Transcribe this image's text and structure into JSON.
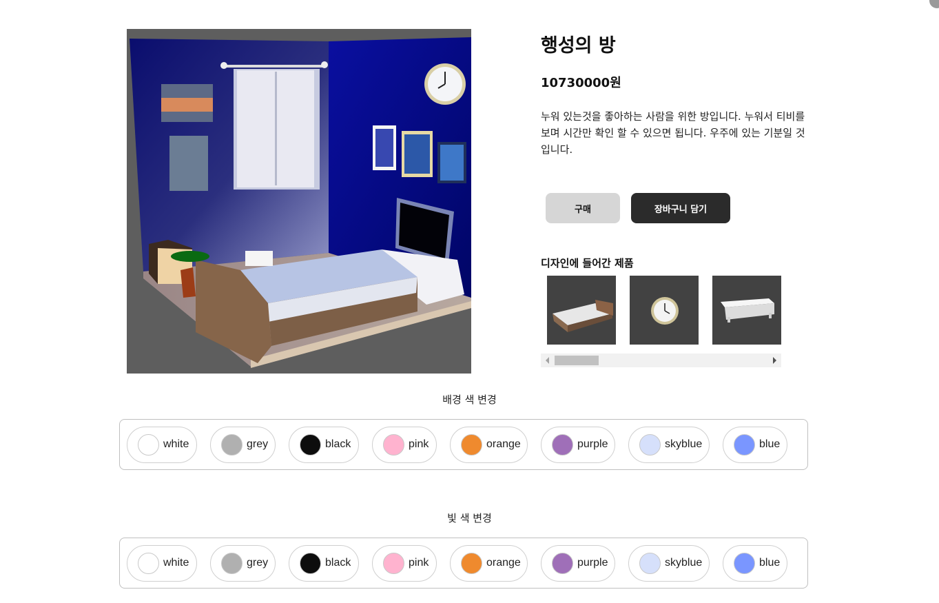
{
  "product": {
    "title": "행성의 방",
    "price": "10730000원",
    "description": "누워 있는것을 좋아하는 사람을 위한 방입니다. 누워서 티비를 보며 시간만 확인 할 수 있으면 됩니다. 우주에 있는 기분일 것입니다."
  },
  "actions": {
    "buy_label": "구매",
    "cart_label": "장바구니 담기"
  },
  "products_section": {
    "heading": "디자인에 들어간 제품",
    "items": [
      "bed",
      "wall-clock",
      "tv-stand"
    ]
  },
  "background_color": {
    "label": "배경 색 변경",
    "options": [
      {
        "name": "white",
        "color": "#ffffff"
      },
      {
        "name": "grey",
        "color": "#b0b0b0"
      },
      {
        "name": "black",
        "color": "#0d0d0d"
      },
      {
        "name": "pink",
        "color": "#ffb3cf"
      },
      {
        "name": "orange",
        "color": "#ef8a2e"
      },
      {
        "name": "purple",
        "color": "#9f6fb8"
      },
      {
        "name": "skyblue",
        "color": "#d6e0fb"
      },
      {
        "name": "blue",
        "color": "#7a96ff"
      }
    ]
  },
  "light_color": {
    "label": "빛 색 변경",
    "options": [
      {
        "name": "white",
        "color": "#ffffff"
      },
      {
        "name": "grey",
        "color": "#b0b0b0"
      },
      {
        "name": "black",
        "color": "#0d0d0d"
      },
      {
        "name": "pink",
        "color": "#ffb3cf"
      },
      {
        "name": "orange",
        "color": "#ef8a2e"
      },
      {
        "name": "purple",
        "color": "#9f6fb8"
      },
      {
        "name": "skyblue",
        "color": "#d6e0fb"
      },
      {
        "name": "blue",
        "color": "#7a96ff"
      }
    ]
  },
  "colors": {
    "dark_button": "#2b2b2b",
    "light_button": "#d6d6d6",
    "wall_blue": "#05087a",
    "thumb_bg": "#424242"
  }
}
